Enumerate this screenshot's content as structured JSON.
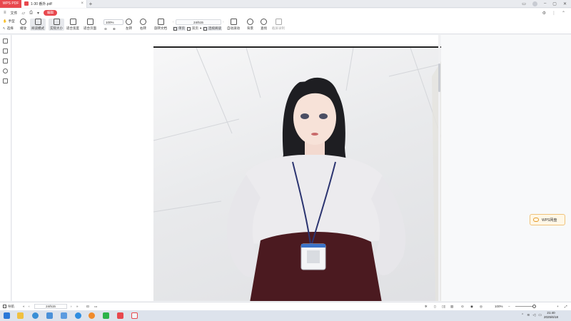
{
  "titlebar": {
    "app_name": "WPS PDF",
    "doc_tab": "1-30 番外.pdf",
    "new_tab": "+"
  },
  "menu": {
    "file_label": "文件",
    "pill_label": "编辑"
  },
  "toolbar": {
    "hand_label": "手型",
    "select_label": "选择",
    "play_label": "播放",
    "read_mode_label": "阅读模式",
    "actual_size_label": "实际大小",
    "fit_width_label": "适合宽度",
    "fit_page_label": "适合页面",
    "zoom_value": "100%",
    "rotate_left_label": "左转",
    "rotate_right_label": "右转",
    "rotate_doc_label": "旋转文档",
    "page_value": "24/515",
    "single_label": "单页",
    "double_label": "双页",
    "continuous_label": "连续阅读",
    "auto_scroll_label": "自动滚动",
    "background_label": "背景",
    "find_label": "查找",
    "screen_record_label": "截屏录制"
  },
  "rightpanel": {
    "netdisk_label": "WPS网盘"
  },
  "statusbar": {
    "nav_label": "导航",
    "page_value": "24/515",
    "zoom_value": "100%"
  },
  "taskbar": {
    "time": "21:40",
    "date": "2025/6/18"
  },
  "colors": {
    "brand": "#e8484e",
    "toolbar_bg": "#ffffff",
    "workspace_bg": "#f8f9fa"
  }
}
